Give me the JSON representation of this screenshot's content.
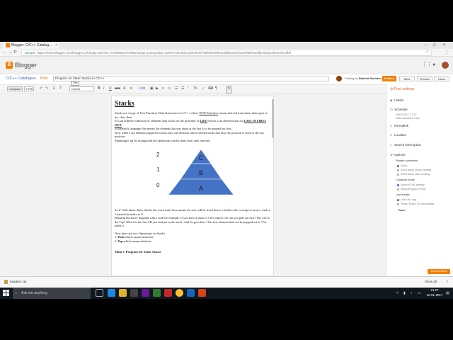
{
  "browser": {
    "tab_title": "Blogger: C/C++ Catalog...",
    "url_secure": "Secure",
    "url": "https://www.blogger.com/blogger.g?blogID=8207917710909827#editor/target=post;postID=8207974415021108?font/Published/Menu/allposts/Closed/Menu/allposts/position/0scd/bk"
  },
  "blogger": {
    "brand": "Blogger",
    "breadcrumb_blog": "C/C++ Catalogue",
    "breadcrumb_post": "Post",
    "post_title": "Program on Static Stacks in C/C++",
    "posting_as_prefix": "Posting as",
    "posting_as_name": "Rakshit Sachdev",
    "buttons": {
      "publish": "Publish",
      "save": "Save",
      "preview": "Preview",
      "close": "Close"
    }
  },
  "toolbar": {
    "compose": "Compose",
    "html": "HTML",
    "format": "Normal",
    "tooltip": "Title"
  },
  "document": {
    "title": "Stacks",
    "p1_a": "Stacks are a type of Non Primitive Data Structures in C/C++ where ",
    "p1_u": "NON Primitive",
    "p1_b": " means derived from basic data types ie: int, char, float.",
    "p2_a": "It is an ordered collection of elements that works on the principle of ",
    "p2_lifo": "LIFO",
    "p2_b": " which is an abbreviation for ",
    "p2_last": "LAST IN FIRST OUT.",
    "p3": "In layman's language this means the element that was input at the last is to be popped out first.",
    "p4": "Now when I say element popped it means only one element can be deleted each time also the position is fixed ie the top position.",
    "p5": "Summing it up by saying both the operations can be done from only one end.",
    "levels": [
      "2",
      "1",
      "0"
    ],
    "pyramid_labels": [
      "C",
      "B",
      "A"
    ],
    "p6": "So if I talk about Static Stacks the word static here means the size will be fixed hence it follows the concept of arrays. And so I started the index as 0.",
    "p7": "Relating the above diagram with a real life example. If you have a stack of CD's which CD can you pull out first? The CD at the Top? Which is the last CD you had put in the stack. And So goes here. The first element that can be popped out is 'C'at index 2",
    "p8": "Now there are two Operations on Stacks",
    "op1_num": "1.",
    "op1_b": "Push",
    "op1_t": " which means insertion.",
    "op2_num": "2.",
    "op2_b": "Pop",
    "op2_t": " which means deletion.",
    "p9": "Main C Program for Static Stacks"
  },
  "panel": {
    "heading": "Post settings",
    "labels": "Labels",
    "schedule": "Schedule",
    "schedule_date": "16/01/2017 21:27",
    "schedule_tz": "India Standard Time",
    "permalink": "Permalink",
    "location": "Location",
    "search_description": "Search Description",
    "options": "Options",
    "reader_comments": "Reader comments",
    "rc_opts": [
      "Allow",
      "Don't allow, show existing",
      "Don't allow, hide existing"
    ],
    "compose_mode": "Compose mode",
    "cm_opts": [
      "Show HTML literally",
      "Interpret typed HTML"
    ],
    "line_breaks": "Line breaks",
    "lb_opts": [
      "Use <br> tag",
      "Press \"Enter\" for line breaks"
    ],
    "done": "Done",
    "send_feedback": "Send feedback"
  },
  "downloads": {
    "file": "headers.zip",
    "show_all": "Show all"
  },
  "taskbar": {
    "search_placeholder": "Ask me anything",
    "time": "21:27",
    "date": "16-01-2017"
  },
  "colors": {
    "accent": "#f57d00",
    "pyramid": "#4472c4",
    "link": "#3367d6"
  }
}
